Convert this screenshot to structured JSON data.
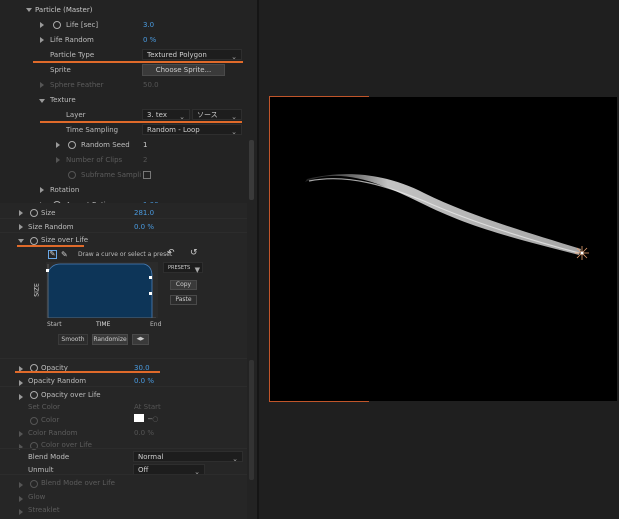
{
  "particle_master": {
    "title": "Particle (Master)",
    "life": {
      "label": "Life [sec]",
      "value": "3.0"
    },
    "life_random": {
      "label": "Life Random",
      "value": "0 %"
    },
    "particle_type": {
      "label": "Particle Type",
      "value": "Textured Polygon"
    },
    "sprite": {
      "label": "Sprite",
      "button": "Choose Sprite..."
    },
    "sphere_feather": {
      "label": "Sphere Feather",
      "value": "50.0"
    },
    "texture": {
      "title": "Texture",
      "layer": {
        "label": "Layer",
        "value": "3. tex",
        "source": "ソース"
      },
      "time_sampling": {
        "label": "Time Sampling",
        "value": "Random - Loop"
      },
      "random_seed": {
        "label": "Random Seed",
        "value": "1"
      },
      "number_of_clips": {
        "label": "Number of Clips",
        "value": "2"
      },
      "subframe_sampling": {
        "label": "Subframe Sampli"
      }
    },
    "rotation": {
      "label": "Rotation"
    },
    "aspect_ratio": {
      "label": "Aspect Ratio",
      "value": "1.00"
    },
    "size": {
      "label": "Size",
      "value": "281.0"
    },
    "size_random": {
      "label": "Size Random",
      "value": "0.0 %"
    },
    "size_over_life": {
      "label": "Size over Life",
      "hint": "Draw a curve or select a preset",
      "presets": "PRESETS",
      "copy": "Copy",
      "paste": "Paste",
      "axis_y": "SIZE",
      "axis_start": "Start",
      "axis_time": "TIME",
      "axis_end": "End",
      "smooth": "Smooth",
      "randomize": "Randomize"
    },
    "opacity": {
      "label": "Opacity",
      "value": "30.0"
    },
    "opacity_random": {
      "label": "Opacity Random",
      "value": "0.0 %"
    },
    "opacity_over_life": {
      "label": "Opacity over Life"
    },
    "set_color": {
      "label": "Set Color",
      "value": "At Start"
    },
    "color": {
      "label": "Color"
    },
    "color_random": {
      "label": "Color Random",
      "value": "0.0 %"
    },
    "color_over_life": {
      "label": "Color over Life"
    },
    "blend_mode": {
      "label": "Blend Mode",
      "value": "Normal"
    },
    "unmult": {
      "label": "Unmult",
      "value": "Off"
    },
    "blend_mode_over_life": {
      "label": "Blend Mode over Life"
    },
    "glow": {
      "label": "Glow"
    },
    "streaklet": {
      "label": "Streaklet"
    }
  },
  "colors": {
    "accent_orange": "#e06a2a",
    "value_blue": "#4a9be0",
    "curve_fill": "#0d3558"
  }
}
